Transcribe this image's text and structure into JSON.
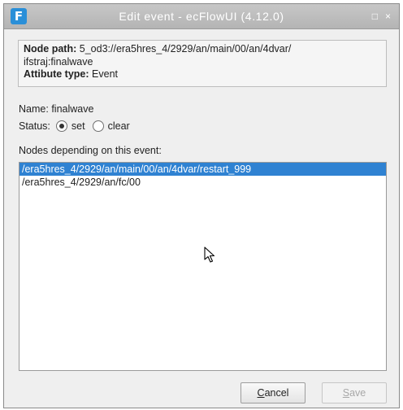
{
  "window": {
    "title": "Edit event  -  ecFlowUI (4.12.0)",
    "app_icon_letter": "F",
    "maximize_glyph": "□",
    "close_glyph": "×"
  },
  "info": {
    "node_path_label": "Node path:",
    "node_path_value": "5_od3://era5hres_4/2929/an/main/00/an/4dvar/",
    "node_path_value_cont": "ifstraj:finalwave",
    "attribute_type_label": "Attibute type:",
    "attribute_type_value": "Event"
  },
  "form": {
    "name_label": "Name:",
    "name_value": "finalwave",
    "status_label": "Status:",
    "status_options": [
      {
        "label": "set",
        "checked": true
      },
      {
        "label": "clear",
        "checked": false
      }
    ]
  },
  "dependents": {
    "label": "Nodes depending on this event:",
    "items": [
      {
        "text": "/era5hres_4/2929/an/main/00/an/4dvar/restart_999",
        "selected": true
      },
      {
        "text": "/era5hres_4/2929/an/fc/00",
        "selected": false
      }
    ]
  },
  "buttons": {
    "cancel_first": "C",
    "cancel_rest": "ancel",
    "save_first": "S",
    "save_rest": "ave",
    "save_enabled": false
  },
  "colors": {
    "selection": "#2f82d2",
    "app_icon": "#2a8fd8",
    "titlebar": "#b4b4b4"
  }
}
